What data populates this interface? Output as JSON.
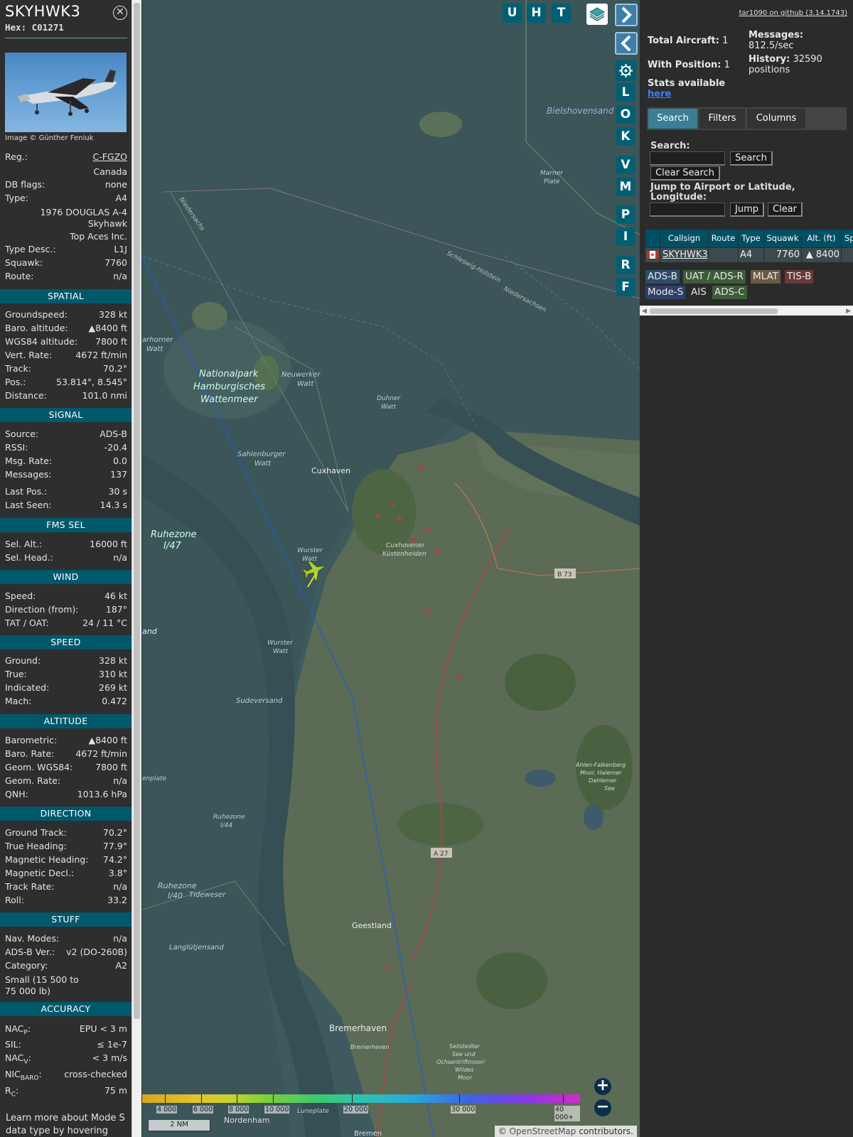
{
  "aircraft": {
    "callsign": "SKYHWK3",
    "hex": "Hex: C01271",
    "photo_credit": "Image © Günther Feniuk",
    "reg_label": "Reg.:",
    "reg": "C-FGZO",
    "country": "Canada",
    "dbflags_label": "DB flags:",
    "dbflags": "none",
    "type_label": "Type:",
    "type": "A4",
    "model_line1": "1976 DOUGLAS A-4",
    "model_line2": "Skyhawk",
    "operator": "Top Aces Inc.",
    "typedesc_label": "Type Desc.:",
    "typedesc": "L1J",
    "squawk_label": "Squawk:",
    "squawk": "7760",
    "route_label": "Route:",
    "route": "n/a"
  },
  "sections": {
    "spatial": "SPATIAL",
    "signal": "SIGNAL",
    "fms": "FMS SEL",
    "wind": "WIND",
    "speed": "SPEED",
    "altitude": "ALTITUDE",
    "direction": "DIRECTION",
    "stuff": "STUFF",
    "accuracy": "ACCURACY"
  },
  "spatial": [
    {
      "k": "Groundspeed:",
      "v": "328 kt"
    },
    {
      "k": "Baro. altitude:",
      "v": "▲8400 ft"
    },
    {
      "k": "WGS84 altitude:",
      "v": "7800 ft"
    },
    {
      "k": "Vert. Rate:",
      "v": "4672 ft/min"
    },
    {
      "k": "Track:",
      "v": "70.2°"
    },
    {
      "k": "Pos.:",
      "v": "53.814°, 8.545°"
    },
    {
      "k": "Distance:",
      "v": "101.0 nmi"
    }
  ],
  "signal": [
    {
      "k": "Source:",
      "v": "ADS-B"
    },
    {
      "k": "RSSI:",
      "v": "-20.4"
    },
    {
      "k": "Msg. Rate:",
      "v": "0.0"
    },
    {
      "k": "Messages:",
      "v": "137"
    },
    {
      "k": "Last Pos.:",
      "v": "30 s"
    },
    {
      "k": "Last Seen:",
      "v": "14.3 s"
    }
  ],
  "fms": [
    {
      "k": "Sel. Alt.:",
      "v": "16000 ft"
    },
    {
      "k": "Sel. Head.:",
      "v": "n/a"
    }
  ],
  "wind": [
    {
      "k": "Speed:",
      "v": "46 kt"
    },
    {
      "k": "Direction (from):",
      "v": "187°"
    },
    {
      "k": "TAT / OAT:",
      "v": "24 / 11 °C"
    }
  ],
  "speed": [
    {
      "k": "Ground:",
      "v": "328 kt"
    },
    {
      "k": "True:",
      "v": "310 kt"
    },
    {
      "k": "Indicated:",
      "v": "269 kt"
    },
    {
      "k": "Mach:",
      "v": "0.472"
    }
  ],
  "altitude": [
    {
      "k": "Barometric:",
      "v": "▲8400 ft"
    },
    {
      "k": "Baro. Rate:",
      "v": "4672 ft/min"
    },
    {
      "k": "Geom. WGS84:",
      "v": "7800 ft"
    },
    {
      "k": "Geom. Rate:",
      "v": "n/a"
    },
    {
      "k": "QNH:",
      "v": "1013.6 hPa"
    }
  ],
  "direction": [
    {
      "k": "Ground Track:",
      "v": "70.2°"
    },
    {
      "k": "True Heading:",
      "v": "77.9°"
    },
    {
      "k": "Magnetic Heading:",
      "v": "74.2°"
    },
    {
      "k": "Magnetic Decl.:",
      "v": "3.8°"
    },
    {
      "k": "Track Rate:",
      "v": "n/a"
    },
    {
      "k": "Roll:",
      "v": "33.2"
    }
  ],
  "stuff": {
    "nav_k": "Nav. Modes:",
    "nav_v": "n/a",
    "adsb_k": "ADS-B Ver.:",
    "adsb_v": "v2 (DO-260B)",
    "cat_k": "Category:",
    "cat_v": "A2",
    "cat_desc1": "Small (15 500 to",
    "cat_desc2": "75 000 lb)"
  },
  "accuracy": [
    {
      "k": "NACP:",
      "v": "EPU < 3 m"
    },
    {
      "k": "SIL:",
      "v": "≤ 1e-7"
    },
    {
      "k": "NACV:",
      "v": "< 3 m/s"
    },
    {
      "k": "NICBARO:",
      "v": "cross-checked"
    },
    {
      "k": "RC:",
      "v": "75 m"
    }
  ],
  "footer": {
    "line1": "Learn more about Mode S",
    "line2": "data type by hovering over"
  },
  "map": {
    "buttons_top": [
      "U",
      "H",
      "T"
    ],
    "buttons_side": [
      "L",
      "O",
      "K",
      "V",
      "M",
      "P",
      "I",
      "R",
      "F"
    ],
    "places": {
      "cuxhaven": "Cuxhaven",
      "geestland": "Geestland",
      "bremerhaven": "Bremerhaven",
      "nordenham": "Nordenham",
      "bielshoven": "Bielshovensand",
      "nationalpark1": "Nationalpark",
      "nationalpark2": "Hamburgisches",
      "nationalpark3": "Wattenmeer",
      "neuwerker1": "Neuwerker",
      "neuwerker2": "Watt",
      "duhner1": "Duhner",
      "duhner2": "Watt",
      "sahlenburger1": "Sahlenburger",
      "sahlenburger2": "Watt",
      "ruhezone1": "Ruhezone",
      "ruhezone2": "I/47",
      "wurster1": "Wurster",
      "wurster2": "Watt",
      "wurster3": "Wurster",
      "wurster4": "Watt",
      "cuxhoven1": "Cuxhovener",
      "cuxhoven2": "Küstenheiden",
      "sudeversand": "Sudeversand",
      "marner1": "Marner",
      "marner2": "Plate",
      "harhorner1": "arhorner",
      "harhorner2": "Watt",
      "niedersachs": "Niedersachs",
      "schleswig": "Schleswig-Holstein",
      "niedersachsen2": "Niedersachsen",
      "ruhezone44a": "Ruhezone",
      "ruhezone44b": "I/44",
      "tideweser": "Tideweser",
      "ruhezone40a": "Ruhezone",
      "ruhezone40b": "I/40",
      "langlutjensand": "Langlütjensand",
      "ahlen1": "Ahlen-Falkenberg",
      "ahlen2": "Moor, Halemer",
      "ahlen3": "Dahlemer",
      "ahlen4": "See",
      "sellstedt1": "Sellstedter",
      "sellstedt2": "See und",
      "sellstedt3": "Ochsentriftmoor/",
      "sellstedt4": "Wildes",
      "sellstedt5": "Moor",
      "bremerhaven2": "Bremerhaven",
      "bremen": "Bremen",
      "luneplate": "Luneplate",
      "enplate": "enplate",
      "land": "and",
      "b73": "B 73",
      "a27": "A 27"
    },
    "scale_label": "2 NM",
    "attribution_prefix": "©",
    "attribution_link": "OpenStreetMap",
    "attribution_suffix": "contributors.",
    "legend_labels": [
      "4 000",
      "6 000",
      "8 000",
      "10 000",
      "20 000",
      "30 000",
      "40 000+"
    ],
    "zoom_in": "+",
    "zoom_out": "−"
  },
  "right": {
    "version": "tar1090 on github (3.14.1743)",
    "total_aircraft_label": "Total Aircraft:",
    "total_aircraft": "1",
    "messages_label": "Messages:",
    "messages_value": "812.5/sec",
    "with_position_label": "With Position:",
    "with_position": "1",
    "history_label": "History:",
    "history_value": "32590",
    "history_unit": "positions",
    "stats_label": "Stats available",
    "stats_link": "here",
    "tabs": [
      "Search",
      "Filters",
      "Columns"
    ],
    "search_label": "Search:",
    "search_button": "Search",
    "clear_search_button": "Clear Search",
    "jump_label1": "Jump to Airport or Latitude,",
    "jump_label2": "Longitude:",
    "jump_button": "Jump",
    "clear_button": "Clear",
    "table": {
      "headers": [
        "Callsign",
        "Route",
        "Type",
        "Squawk",
        "Alt. (ft)",
        "Sp"
      ],
      "row": {
        "callsign": "SKYHWK3",
        "route": "",
        "type": "A4",
        "squawk": "7760",
        "alt": "▲ 8400"
      }
    },
    "chips": [
      "ADS-B",
      "UAT / ADS-R",
      "MLAT",
      "TIS-B",
      "Mode-S",
      "AIS",
      "ADS-C"
    ]
  },
  "colors": {
    "accent": "#00596b",
    "button": "#005f73",
    "tab_active": "#3a7f95",
    "chip_adsb": "#2e4d6b",
    "chip_uat": "#3d5b3a",
    "chip_mlat": "#6b5a45",
    "chip_tisb": "#6a3a3a",
    "chip_modes": "#2f3f6b",
    "chip_adsc": "#3d5b3a"
  }
}
